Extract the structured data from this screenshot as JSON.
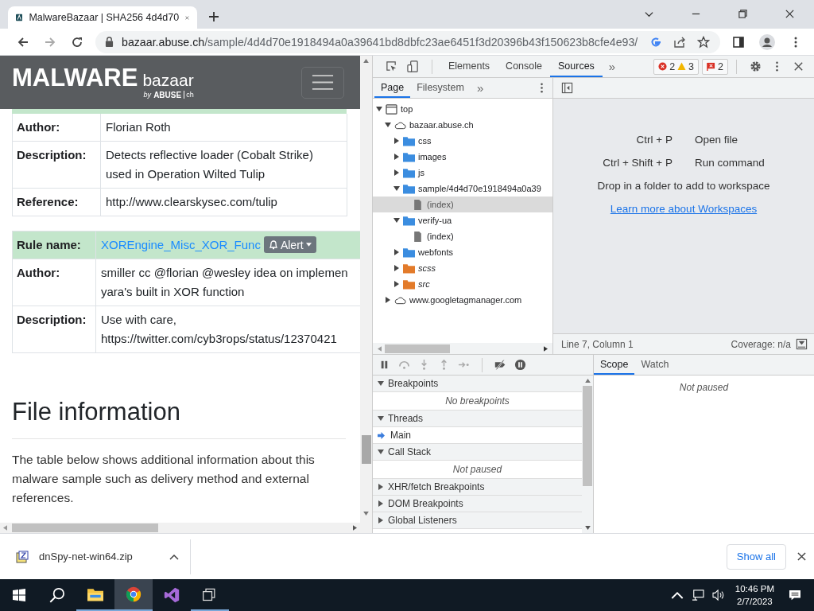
{
  "browser": {
    "tab_title": "MalwareBazaar | SHA256 4d4d70",
    "url_host": "bazaar.abuse.ch",
    "url_path": "/sample/4d4d70e1918494a0a39641bd8dbfc23ae6451f3d20396b43f150623b8cfe4e93/"
  },
  "page": {
    "logo": {
      "word1": "MALWARE",
      "word2": "bazaar",
      "by": "by",
      "brand": "ABUSE",
      "suffix": "ch"
    },
    "rule_tables": [
      {
        "rows": [
          {
            "kind": "plain",
            "label": "Author:",
            "value": "Florian Roth"
          },
          {
            "kind": "plain",
            "label": "Description:",
            "value": "Detects reflective loader (Cobalt Strike)\nused in Operation Wilted Tulip"
          },
          {
            "kind": "plain",
            "label": "Reference:",
            "value": "http://www.clearskysec.com/tulip"
          }
        ]
      },
      {
        "rows": [
          {
            "kind": "rule",
            "label": "Rule name:",
            "value": "XOREngine_Misc_XOR_Func",
            "badge": "Alert"
          },
          {
            "kind": "plain",
            "label": "Author:",
            "value": "smiller cc @florian @wesley idea on implemen\nyara's built in XOR function"
          },
          {
            "kind": "plain",
            "label": "Description:",
            "value": "Use with care,\nhttps://twitter.com/cyb3rops/status/12370421"
          }
        ]
      }
    ],
    "heading": "File information",
    "paragraph": "The table below shows additional information about this malware sample such as delivery method and external references."
  },
  "devtools": {
    "tabs": [
      {
        "label": "Elements",
        "selected": false
      },
      {
        "label": "Console",
        "selected": false
      },
      {
        "label": "Sources",
        "selected": true
      }
    ],
    "more_tabs": "»",
    "issues": {
      "errors": "2",
      "warnings": "3",
      "flags": "2"
    },
    "navigator_tabs": [
      {
        "label": "Page",
        "selected": true
      },
      {
        "label": "Filesystem",
        "selected": false
      }
    ],
    "tree": [
      {
        "kind": "frame",
        "label": "top",
        "expanded": true,
        "selected": false,
        "children": [
          {
            "kind": "domain",
            "label": "bazaar.abuse.ch",
            "expanded": true,
            "selected": false,
            "children": [
              {
                "kind": "folder",
                "label": "css",
                "expanded": false,
                "selected": false
              },
              {
                "kind": "folder",
                "label": "images",
                "expanded": false,
                "selected": false
              },
              {
                "kind": "folder",
                "label": "js",
                "expanded": false,
                "selected": false
              },
              {
                "kind": "folder",
                "label": "sample/4d4d70e1918494a0a39",
                "expanded": true,
                "selected": false,
                "children": [
                  {
                    "kind": "file",
                    "label": "(index)",
                    "selected": true
                  }
                ]
              },
              {
                "kind": "folder",
                "label": "verify-ua",
                "expanded": true,
                "selected": false,
                "children": [
                  {
                    "kind": "file",
                    "label": "(index)",
                    "selected": false
                  }
                ]
              },
              {
                "kind": "folder",
                "label": "webfonts",
                "expanded": false,
                "selected": false
              },
              {
                "kind": "mapped-folder",
                "label": "scss",
                "expanded": false,
                "selected": false
              },
              {
                "kind": "mapped-folder",
                "label": "src",
                "expanded": false,
                "selected": false
              }
            ]
          },
          {
            "kind": "domain",
            "label": "www.googletagmanager.com",
            "expanded": false,
            "selected": false
          }
        ]
      }
    ],
    "shortcuts": [
      {
        "keys": "Ctrl + P",
        "action": "Open file"
      },
      {
        "keys": "Ctrl + Shift + P",
        "action": "Run command"
      }
    ],
    "drop_hint": "Drop in a folder to add to workspace",
    "workspace_link": "Learn more about Workspaces",
    "status_position": "Line 7, Column 1",
    "coverage": "Coverage: n/a",
    "sections": [
      {
        "title": "Breakpoints",
        "expanded": true,
        "body": "No breakpoints"
      },
      {
        "title": "Threads",
        "expanded": true,
        "threads": [
          {
            "name": "Main",
            "selected": true
          }
        ]
      },
      {
        "title": "Call Stack",
        "expanded": true,
        "body": "Not paused"
      },
      {
        "title": "XHR/fetch Breakpoints",
        "expanded": false
      },
      {
        "title": "DOM Breakpoints",
        "expanded": false
      },
      {
        "title": "Global Listeners",
        "expanded": false
      }
    ],
    "sidebar_tabs": [
      {
        "label": "Scope",
        "selected": true
      },
      {
        "label": "Watch",
        "selected": false
      }
    ],
    "scope_message": "Not paused"
  },
  "download": {
    "file": "dnSpy-net-win64.zip",
    "show_all": "Show all"
  },
  "taskbar": {
    "apps": [
      {
        "kind": "explorer",
        "running": true,
        "selected": false
      },
      {
        "kind": "chrome",
        "running": true,
        "selected": true
      },
      {
        "kind": "visual-studio",
        "running": false,
        "selected": false
      },
      {
        "kind": "windows",
        "running": true,
        "selected": false
      }
    ],
    "time": "10:46 PM",
    "date": "2/7/2023"
  }
}
